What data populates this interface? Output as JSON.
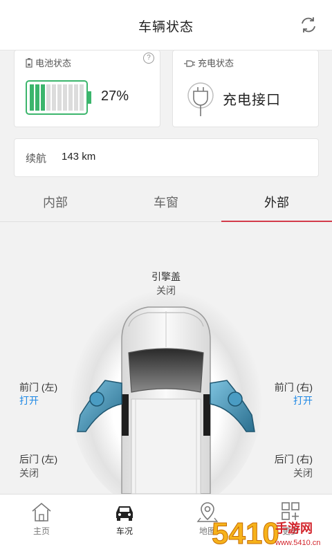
{
  "header": {
    "title": "车辆状态",
    "refresh_icon": "refresh-icon"
  },
  "battery": {
    "title": "电池状态",
    "percent": 0.27,
    "percent_label": "27%",
    "help": "?",
    "color": "#3bb56c"
  },
  "charging": {
    "title": "充电状态",
    "status": "充电接口"
  },
  "range": {
    "label": "续航",
    "value": "143 km"
  },
  "tabs": [
    {
      "label": "内部"
    },
    {
      "label": "车窗"
    },
    {
      "label": "外部"
    }
  ],
  "active_tab": 2,
  "car": {
    "hood": {
      "label": "引擎盖",
      "state": "关闭"
    },
    "front_left": {
      "label": "前门 (左)",
      "state": "打开"
    },
    "front_right": {
      "label": "前门 (右)",
      "state": "打开"
    },
    "rear_left": {
      "label": "后门 (左)",
      "state": "关闭"
    },
    "rear_right": {
      "label": "后门 (右)",
      "state": "关闭"
    }
  },
  "nav": [
    {
      "label": "主页",
      "icon": "home-icon"
    },
    {
      "label": "车况",
      "icon": "car-icon"
    },
    {
      "label": "地图",
      "icon": "map-pin-icon"
    },
    {
      "label": "更多",
      "icon": "grid-plus-icon"
    }
  ],
  "watermark": {
    "text": "手游网",
    "number": "5410",
    "domain": "www.5410.cn"
  },
  "colors": {
    "accent": "#d33b4a",
    "open": "#1e88e5"
  }
}
